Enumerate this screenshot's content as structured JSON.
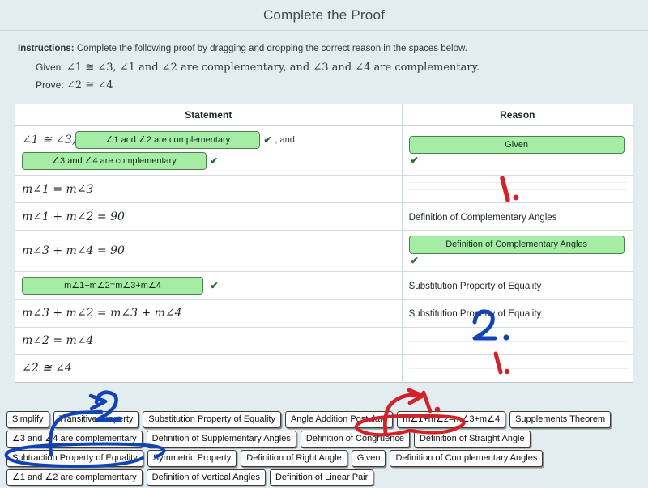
{
  "header": {
    "title": "Complete the Proof"
  },
  "instructions": {
    "lead": "Instructions:",
    "text": " Complete the following proof by dragging and dropping the correct reason in the spaces below.",
    "given_label": "Given:",
    "given_text": "∠1 ≅ ∠3, ∠1 and ∠2 are complementary, and ∠3 and ∠4 are complementary.",
    "prove_label": "Prove:",
    "prove_text": "∠2 ≅ ∠4"
  },
  "table": {
    "headers": {
      "statement": "Statement",
      "reason": "Reason"
    },
    "rows": [
      {
        "statement_prefix": "∠1 ≅ ∠3,",
        "statement_chip_1": "∠1 and ∠2 are complementary",
        "statement_mid": ", and",
        "statement_chip_2": "∠3 and ∠4 are complementary",
        "reason_chip": "Given"
      },
      {
        "statement": "m∠1 = m∠3",
        "reason": ""
      },
      {
        "statement": "m∠1 + m∠2 = 90",
        "reason": "Definition of Complementary Angles"
      },
      {
        "statement": "m∠3 + m∠4 = 90",
        "reason_chip": "Definition of Complementary Angles"
      },
      {
        "statement_chip": "m∠1+m∠2=m∠3+m∠4",
        "reason": "Substitution Property of Equality"
      },
      {
        "statement": "m∠3 + m∠2 = m∠3 + m∠4",
        "reason": "Substitution Property of Equality"
      },
      {
        "statement": "m∠2 = m∠4",
        "reason": ""
      },
      {
        "statement": "∠2 ≅ ∠4",
        "reason": ""
      }
    ],
    "checkmark": "✔"
  },
  "word_bank": {
    "rows": [
      [
        "Simplify",
        "Transitive Property",
        "Substitution Property of Equality",
        "Angle Addition Postulate",
        "m∠1+m∠2=m∠3+m∠4",
        "Supplements Theorem"
      ],
      [
        "∠3 and ∠4 are complementary",
        "Definition of Supplementary Angles",
        "Definition of Congruence",
        "Definition of Straight Angle"
      ],
      [
        "Subtraction Property of Equality",
        "Symmetric Property",
        "Definition of Right Angle",
        "Given",
        "Definition of Complementary Angles"
      ],
      [
        "∠1 and ∠2 are complementary",
        "Definition of Vertical Angles",
        "Definition of Linear Pair"
      ]
    ]
  },
  "annotations": {
    "red_mark_1_table": "1.",
    "red_mark_1_bottom_table": "1.",
    "red_mark_1_bank": "1.",
    "blue_mark_2_table": "2.",
    "blue_mark_2_bank": "2.",
    "red_color": "#d12229",
    "blue_color": "#1243b5",
    "red_circled_chip": "Definition of Congruence",
    "blue_circled_chip": "Subtraction Property of Equality"
  },
  "colors": {
    "page_background": "#e3edf0",
    "chip_green_fill": "#a5eda5",
    "chip_green_border": "#4f7f4f",
    "table_border": "#b9c6cb"
  }
}
